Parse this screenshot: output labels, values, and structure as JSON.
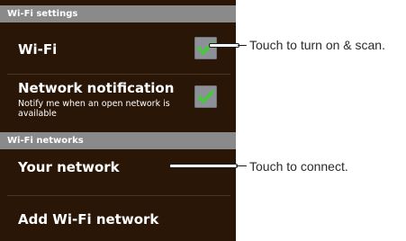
{
  "sections": {
    "wifi_settings": "Wi-Fi settings",
    "wifi_networks": "Wi-Fi networks"
  },
  "rows": {
    "wifi": {
      "label": "Wi-Fi",
      "checked": true
    },
    "network_notification": {
      "label": "Network notification",
      "summary": "Notify me when an open network is available",
      "checked": true
    },
    "your_network": {
      "label": "Your network"
    },
    "add_network": {
      "label": "Add Wi-Fi network"
    }
  },
  "callouts": {
    "scan": "Touch to turn on & scan.",
    "connect": "Touch to connect."
  },
  "colors": {
    "background": "#2a1607",
    "section_header": "#8a8a8a",
    "check_green": "#3fcf2e"
  },
  "icons": {
    "checkbox": "green-check-icon"
  }
}
